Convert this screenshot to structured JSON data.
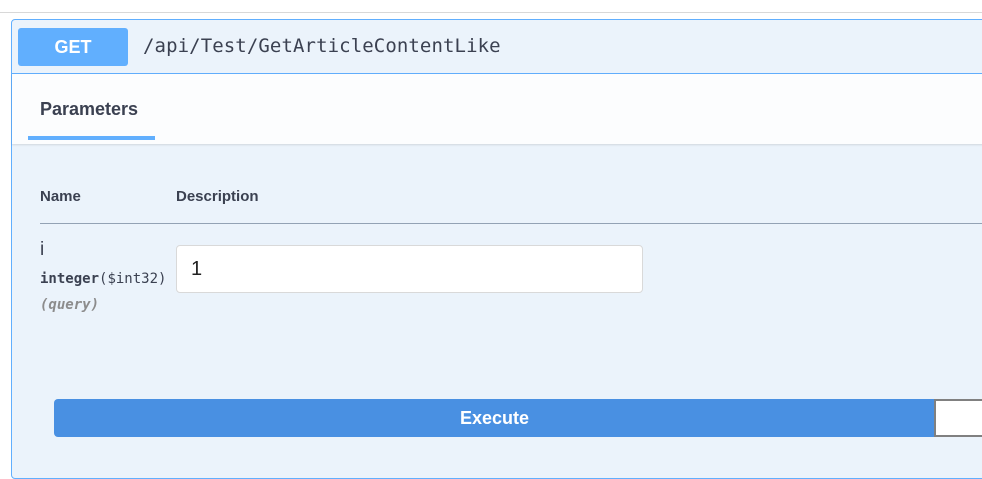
{
  "operation": {
    "method": "GET",
    "path": "/api/Test/GetArticleContentLike"
  },
  "tabs": {
    "parameters_label": "Parameters"
  },
  "parameters_table": {
    "headers": {
      "name": "Name",
      "description": "Description"
    },
    "rows": [
      {
        "name": "i",
        "type": "integer",
        "format": "($int32)",
        "location": "(query)",
        "value": "1"
      }
    ]
  },
  "actions": {
    "execute_label": "Execute"
  },
  "colors": {
    "get_accent": "#61affe",
    "execute": "#4990e2",
    "block_bg": "#ebf3fb",
    "text": "#3b4151"
  }
}
